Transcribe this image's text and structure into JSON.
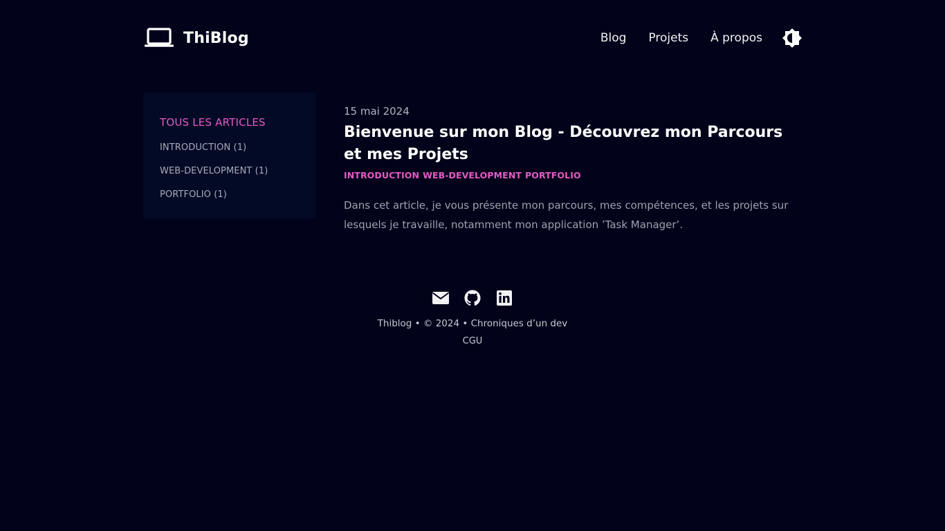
{
  "header": {
    "brand_name": "ThiBlog",
    "logo_icon": "laptop-icon",
    "nav": [
      {
        "label": "Blog"
      },
      {
        "label": "Projets"
      },
      {
        "label": "À propos"
      }
    ],
    "theme_toggle_icon": "brightness-icon"
  },
  "sidebar": {
    "all_articles": "TOUS LES ARTICLES",
    "categories": [
      {
        "label": "INTRODUCTION (1)"
      },
      {
        "label": "WEB-DEVELOPMENT (1)"
      },
      {
        "label": "PORTFOLIO (1)"
      }
    ]
  },
  "article": {
    "date": "15 mai 2024",
    "title": "Bienvenue sur mon Blog - Découvrez mon Parcours et mes Projets",
    "tags": [
      "INTRODUCTION",
      "WEB-DEVELOPMENT",
      "PORTFOLIO"
    ],
    "excerpt": "Dans cet article, je vous présente mon parcours, mes compétences, et les projets sur lesquels je travaille, notamment mon application ’Task Manager’."
  },
  "footer": {
    "social_icons": [
      "mail-icon",
      "github-icon",
      "linkedin-icon"
    ],
    "credits": "Thiblog • © 2024 • Chroniques d’un dev",
    "cgu": "CGU"
  },
  "colors": {
    "background": "#02021a",
    "sidebar_bg": "#020a26",
    "accent": "#e55cc3",
    "text": "#ffffff",
    "muted": "#9fa1ae"
  }
}
